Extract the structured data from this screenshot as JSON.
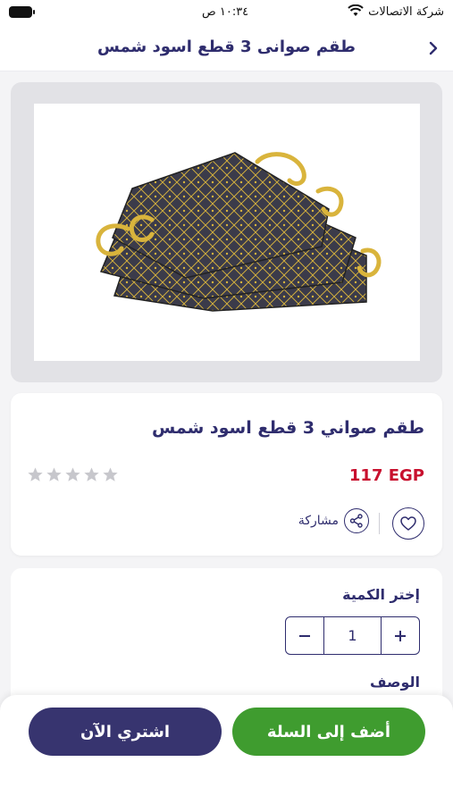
{
  "status_bar": {
    "carrier": "شركة الاتصالات",
    "time": "١٠:٣٤ ص"
  },
  "header": {
    "title": "طقم صوانى 3 قطع اسود شمس"
  },
  "product": {
    "title": "طقم صواني 3 قطع اسود شمس",
    "price": "117 EGP",
    "rating": 0,
    "rating_max": 5,
    "share_label": "مشاركة"
  },
  "quantity": {
    "label": "إختر الكمية",
    "value": "1"
  },
  "description": {
    "label": "الوصف"
  },
  "actions": {
    "add_to_cart": "أضف إلى السلة",
    "buy_now": "اشتري الآن"
  },
  "colors": {
    "brand": "#2f2d6e",
    "price": "#c8102e",
    "cart": "#3f9c2f",
    "buy": "#37346f",
    "tray": "#3b3b4a",
    "gold": "#d9b43c"
  }
}
